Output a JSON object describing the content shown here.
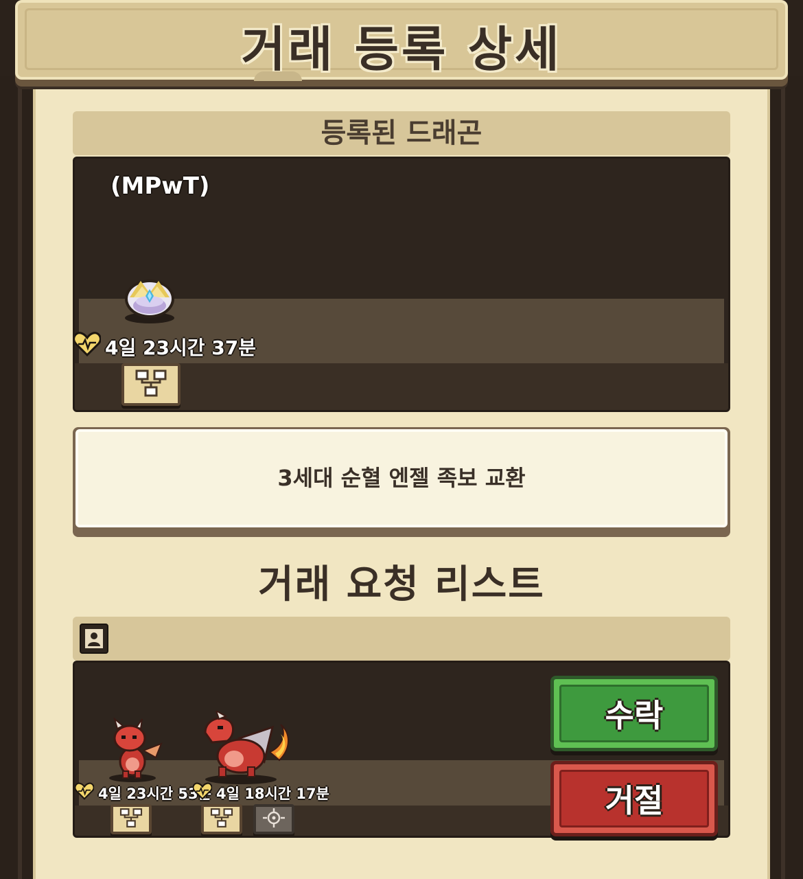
{
  "header": {
    "title": "거래 등록 상세"
  },
  "registered": {
    "section_title": "등록된 드래곤",
    "nickname": "(MPwT)",
    "timer": "4일 23시간 37분"
  },
  "description": "3세대 순혈 엔젤 족보 교환",
  "request_list": {
    "title": "거래 요청 리스트",
    "dragons": [
      {
        "timer": "4일 23시간 53분"
      },
      {
        "timer": "4일 18시간 17분"
      }
    ],
    "accept_label": "수락",
    "reject_label": "거절"
  },
  "colors": {
    "panel": "#f1e6c2",
    "dark_box": "#2e251e",
    "accept": "#5fc053",
    "reject": "#d9584c"
  }
}
